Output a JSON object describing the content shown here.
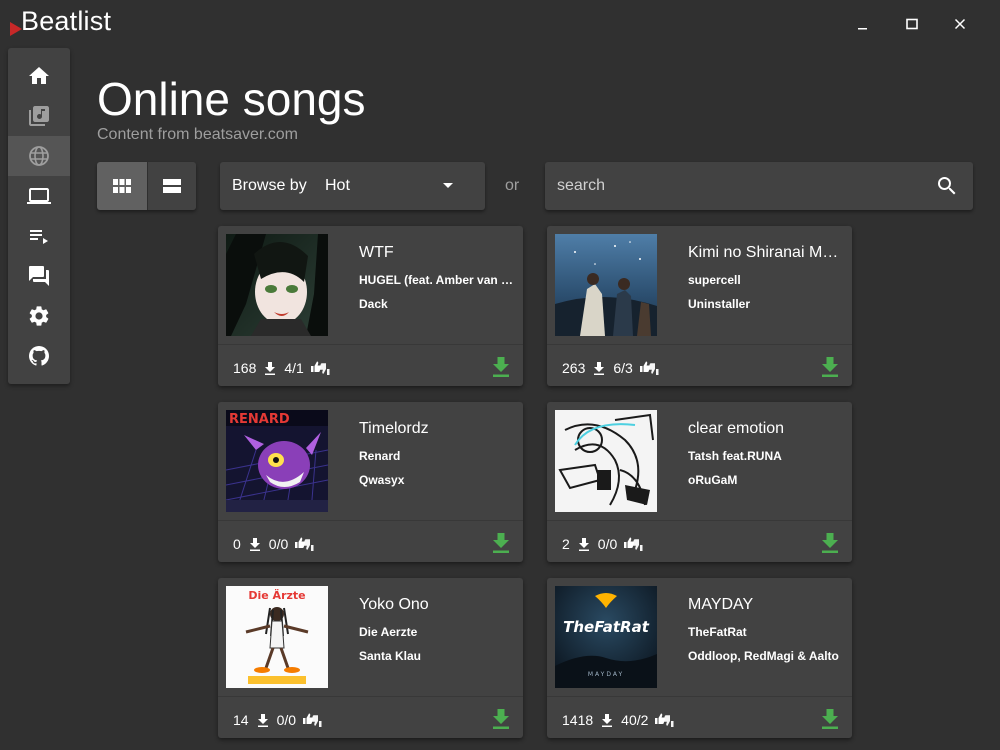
{
  "app": {
    "title": "Beatlist"
  },
  "window_controls": {
    "minimize": "minimize-icon",
    "maximize": "maximize-icon",
    "close": "close-icon"
  },
  "sidebar": {
    "items": [
      {
        "icon": "home-icon",
        "active": false
      },
      {
        "icon": "library-music-icon",
        "active": false
      },
      {
        "icon": "globe-icon",
        "active": true
      },
      {
        "icon": "laptop-icon",
        "active": false
      },
      {
        "icon": "playlist-icon",
        "active": false
      },
      {
        "icon": "chat-icon",
        "active": false
      },
      {
        "icon": "gear-icon",
        "active": false
      },
      {
        "icon": "github-icon",
        "active": false
      }
    ]
  },
  "header": {
    "title": "Online songs",
    "subtitle": "Content from beatsaver.com"
  },
  "toolbar": {
    "view_modes": [
      {
        "icon": "grid-view-icon",
        "active": true
      },
      {
        "icon": "list-view-icon",
        "active": false
      }
    ],
    "browse_label": "Browse by",
    "browse_value": "Hot",
    "or_text": "or",
    "search_placeholder": "search"
  },
  "songs": [
    {
      "title": "WTF",
      "artist": "HUGEL (feat. Amber van Day)",
      "mapper": "Dack",
      "downloads": "168",
      "votes": "4/1"
    },
    {
      "title": "Kimi no Shiranai Monogatari",
      "artist": "supercell",
      "mapper": "Uninstaller",
      "downloads": "263",
      "votes": "6/3"
    },
    {
      "title": "Timelordz",
      "artist": "Renard",
      "mapper": "Qwasyx",
      "downloads": "0",
      "votes": "0/0"
    },
    {
      "title": "clear emotion",
      "artist": "Tatsh feat.RUNA",
      "mapper": "oRuGaM",
      "downloads": "2",
      "votes": "0/0"
    },
    {
      "title": "Yoko Ono",
      "artist": "Die Aerzte",
      "mapper": "Santa Klau",
      "downloads": "14",
      "votes": "0/0"
    },
    {
      "title": "MAYDAY",
      "artist": "TheFatRat",
      "mapper": "Oddloop, RedMagi & Aalto",
      "downloads": "1418",
      "votes": "40/2"
    }
  ],
  "cover_texts": {
    "renard": "RENARD",
    "thefatrat": "TheFatRat",
    "mayday": "MAYDAY",
    "die_aerzte": "Die Ärzte"
  },
  "colors": {
    "background": "#303030",
    "surface": "#424242",
    "download_accent": "#4caf50",
    "logo_red": "#c62828"
  }
}
